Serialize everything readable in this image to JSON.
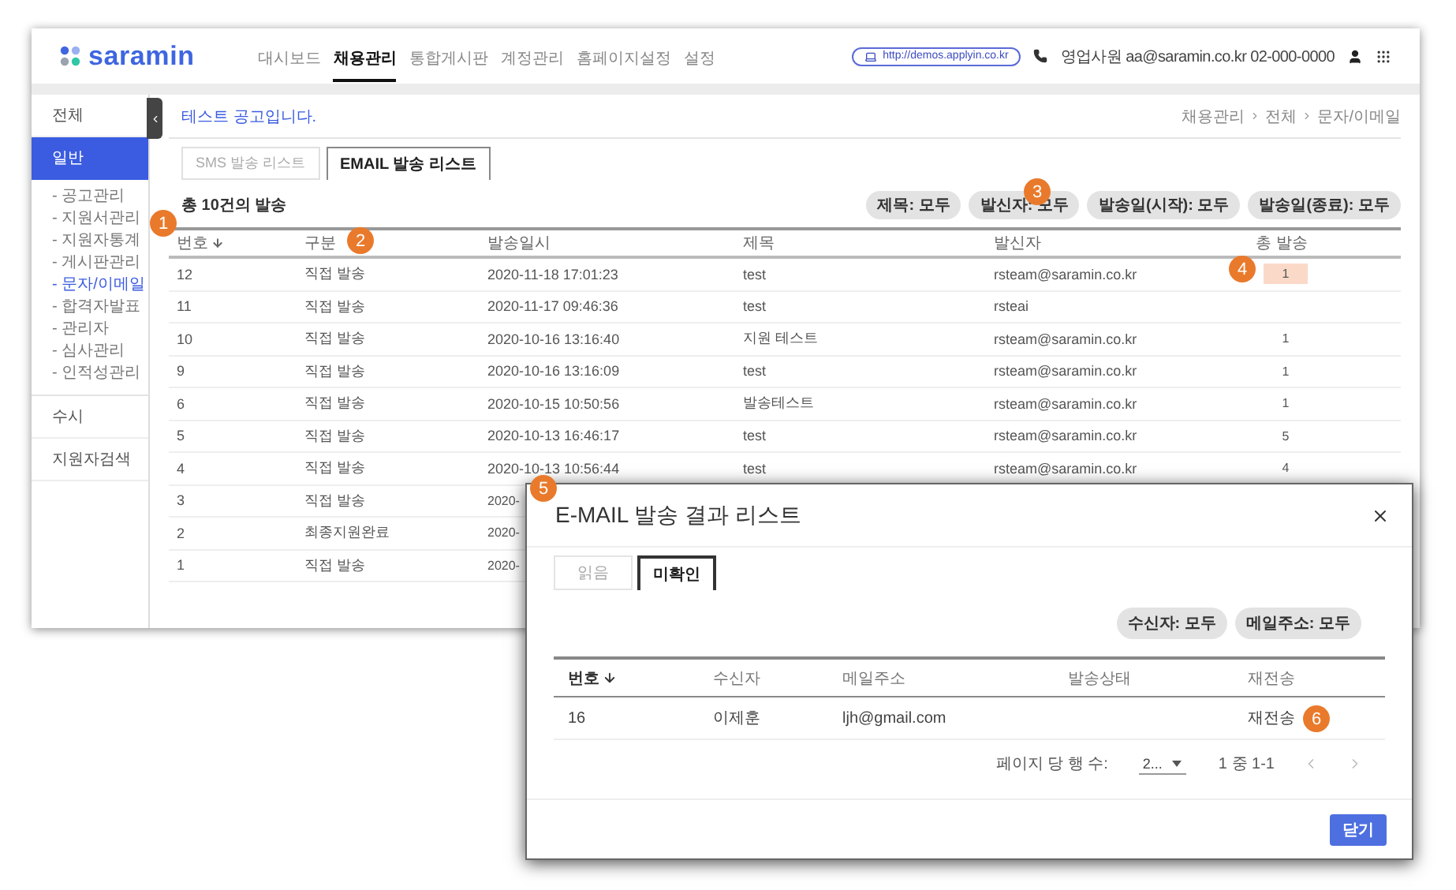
{
  "header": {
    "logo": "saramin",
    "nav": [
      {
        "label": "대시보드",
        "selected": false
      },
      {
        "label": "채용관리",
        "selected": true
      },
      {
        "label": "통합게시판",
        "selected": false
      },
      {
        "label": "계정관리",
        "selected": false
      },
      {
        "label": "홈페이지설정",
        "selected": false
      },
      {
        "label": "설정",
        "selected": false
      }
    ],
    "url": "http://demos.applyin.co.kr",
    "contact": "영업사원 aa@saramin.co.kr 02-000-0000"
  },
  "sidebar": {
    "items": [
      {
        "label": "전체",
        "selected": false
      },
      {
        "label": "일반",
        "selected": true,
        "children": [
          {
            "label": "- 공고관리",
            "selected": false
          },
          {
            "label": "- 지원서관리",
            "selected": false
          },
          {
            "label": "- 지원자통계",
            "selected": false
          },
          {
            "label": "- 게시판관리",
            "selected": false
          },
          {
            "label": "- 문자/이메일",
            "selected": true
          },
          {
            "label": "- 합격자발표",
            "selected": false
          },
          {
            "label": "- 관리자",
            "selected": false
          },
          {
            "label": "- 심사관리",
            "selected": false
          },
          {
            "label": "- 인적성관리",
            "selected": false
          }
        ]
      },
      {
        "label": "수시",
        "selected": false
      },
      {
        "label": "지원자검색",
        "selected": false
      }
    ]
  },
  "content": {
    "title": "테스트 공고입니다.",
    "breadcrumb": [
      "채용관리",
      "전체",
      "문자/이메일"
    ],
    "tabs": [
      {
        "label": "SMS 발송 리스트",
        "selected": false
      },
      {
        "label": "EMAIL 발송 리스트",
        "selected": true
      }
    ],
    "summary": "총 10건의 발송",
    "filters": [
      "제목: 모두",
      "발신자: 모두",
      "발송일(시작): 모두",
      "발송일(종료): 모두"
    ],
    "table": {
      "columns": [
        "번호",
        "구분",
        "발송일시",
        "제목",
        "발신자",
        "총 발송"
      ],
      "rows": [
        {
          "cells": [
            "12",
            "직접 발송",
            "2020-11-18 17:01:23",
            "test",
            "rsteam@saramin.co.kr",
            "1"
          ],
          "highlighted": true
        },
        {
          "cells": [
            "11",
            "직접 발송",
            "2020-11-17 09:46:36",
            "test",
            "rsteai"
          ]
        },
        {
          "cells": [
            "10",
            "직접 발송",
            "2020-10-16 13:16:40",
            "지원 테스트",
            "rsteam@saramin.co.kr",
            "1"
          ]
        },
        {
          "cells": [
            "9",
            "직접 발송",
            "2020-10-16 13:16:09",
            "test",
            "rsteam@saramin.co.kr",
            "1"
          ]
        },
        {
          "cells": [
            "6",
            "직접 발송",
            "2020-10-15 10:50:56",
            "발송테스트",
            "rsteam@saramin.co.kr",
            "1"
          ]
        },
        {
          "cells": [
            "5",
            "직접 발송",
            "2020-10-13 16:46:17",
            "test",
            "rsteam@saramin.co.kr",
            "5"
          ]
        },
        {
          "cells": [
            "4",
            "직접 발송",
            "2020-10-13 10:56:44",
            "test",
            "rsteam@saramin.co.kr",
            "4"
          ]
        },
        {
          "cells": [
            "3",
            "직접 발송",
            "2020-"
          ]
        },
        {
          "cells": [
            "2",
            "최종지원완료",
            "2020-"
          ]
        },
        {
          "cells": [
            "1",
            "직접 발송",
            "2020-"
          ]
        }
      ]
    }
  },
  "modal": {
    "title": "E-MAIL 발송 결과 리스트",
    "tabs": [
      {
        "label": "읽음",
        "selected": false
      },
      {
        "label": "미확인",
        "selected": true
      }
    ],
    "filters": [
      "수신자: 모두",
      "메일주소: 모두"
    ],
    "table": {
      "columns": [
        "번호",
        "수신자",
        "메일주소",
        "발송상태",
        "재전송"
      ],
      "rows": [
        {
          "no": "16",
          "name": "이제훈",
          "email": "ljh@gmail.com",
          "resend": "재전송"
        }
      ]
    },
    "pagination": {
      "label": "페이지 당 행 수:",
      "per_page": "2...",
      "range": "1 중 1-1"
    },
    "close_button": "닫기"
  },
  "annotations": [
    "1",
    "2",
    "3",
    "4",
    "5",
    "6"
  ]
}
